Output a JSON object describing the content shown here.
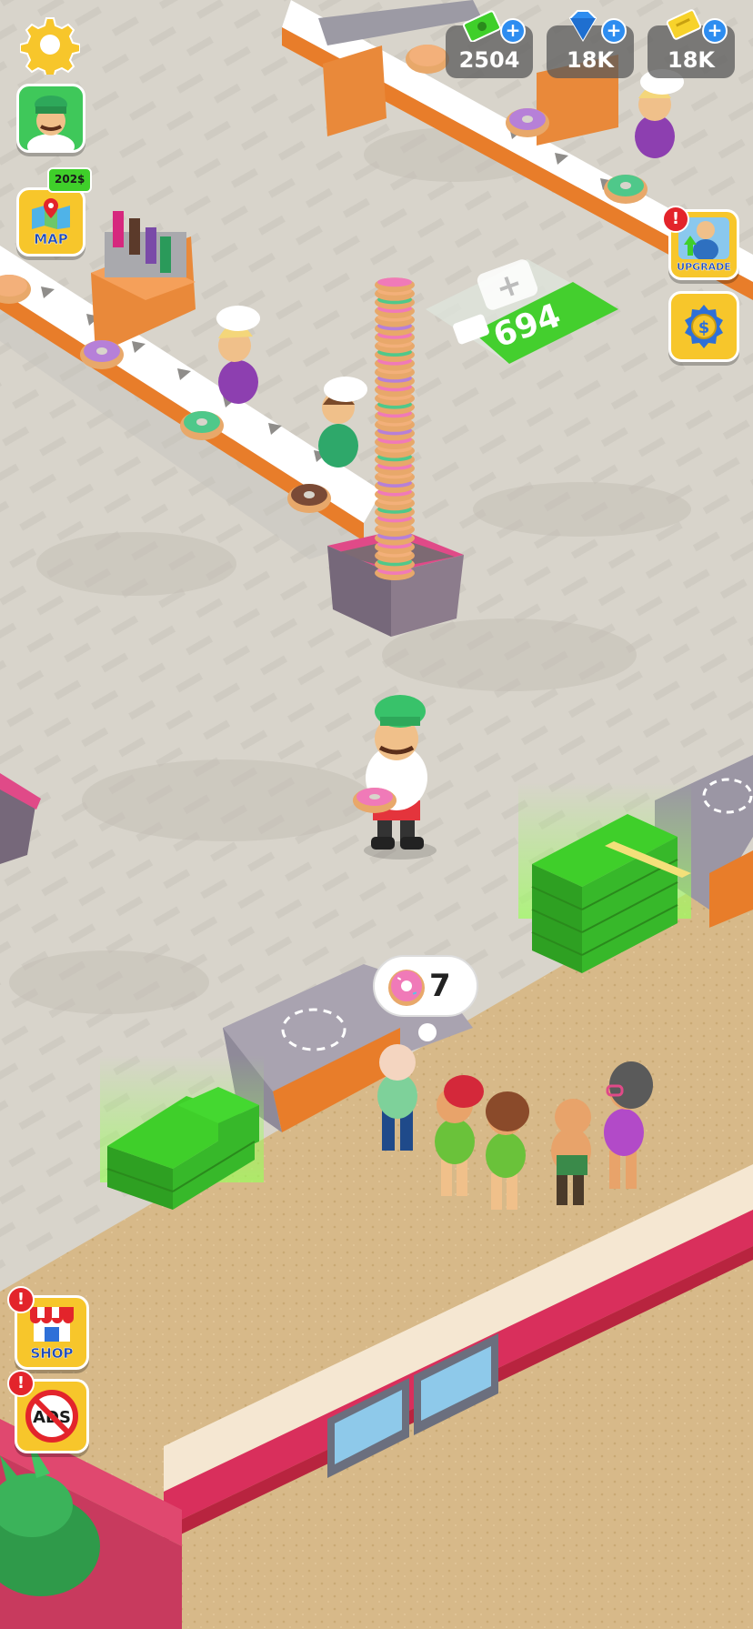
{
  "currencies": {
    "cash": "2504",
    "gems": "18K",
    "tickets": "18K"
  },
  "map_button": {
    "label": "MAP",
    "badge": "202$"
  },
  "upgrade_button": {
    "label": "UPGRADE"
  },
  "shop_button": {
    "label": "SHOP"
  },
  "ads_button": {
    "label": "ADS"
  },
  "alert_symbol": "!",
  "plus_symbol": "+",
  "platform": {
    "amount": "694"
  },
  "customer_request": {
    "count": "7"
  },
  "icons": [
    "settings-gear-icon",
    "profile-avatar-icon",
    "map-pin-icon",
    "cash-icon",
    "gem-icon",
    "ticket-icon",
    "upgrade-icon",
    "coin-icon",
    "shop-icon",
    "no-ads-icon",
    "donut-icon"
  ],
  "colors": {
    "hud_yellow": "#f7c62b",
    "cash_green": "#3fcf2a",
    "gem_blue": "#2e8df0",
    "alert_red": "#e3242b",
    "floor": "#d9d5cd",
    "counter_floor": "#d8b98a"
  }
}
